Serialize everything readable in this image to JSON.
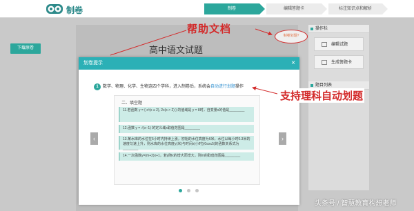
{
  "app": {
    "title": "制卷"
  },
  "steps": [
    {
      "label": "制卷"
    },
    {
      "label": "编辑答题卡"
    },
    {
      "label": "标注知识点和解析"
    }
  ],
  "left": {
    "download_label": "下载原卷"
  },
  "paper": {
    "title": "高中语文试题"
  },
  "annotations": {
    "help_docs": "帮助文档",
    "auto_split": "支持理科自动划题",
    "help_oval_text": "制卷划题?"
  },
  "panel": {
    "header": "操作栏",
    "buttons": [
      "编辑试题",
      "生成答题卡"
    ],
    "header2": "题目列表"
  },
  "modal": {
    "title": "划卷提示",
    "close": "×",
    "step_number": "1",
    "intro_text": "数学、物理、化学、生物这四个学科，进入制卷后，系统会",
    "intro_link": "自动进行划题",
    "intro_tail": "操作",
    "section_title": "二、填空题",
    "questions": [
      "11.若函数 y = { x²(x ≤ 2), 2x(x > 2) } 的值域是 y = 8时，自变量x的值是________",
      "12.函数 y = √(x−1) 的定义域x取值范围是________",
      "13.某水库的水位在5小时内持续上涨，初始的水位高度为6米，水位以每小时0.3米的速度匀速上升，则水库的水位高度y(米)与时间x(小时)(0≤x≤5)的函数关系式为________",
      "14.一次函数y=(m+2)x+1，若y随x的增大而增大，则m的取值范围是________"
    ],
    "prev": "‹",
    "next": "›",
    "active_page": 1,
    "pages": 3
  },
  "watermark": "头条号 / 智慧教育构想老师",
  "colors": {
    "accent": "#2ca79c",
    "annotation": "#d32a2a",
    "modal_header": "#2bb0b6"
  }
}
